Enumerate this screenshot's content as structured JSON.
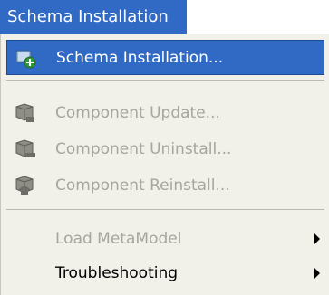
{
  "menubar": {
    "title": "Schema Installation"
  },
  "menu": {
    "items": [
      {
        "label": "Schema Installation...",
        "icon": "schema-install-icon",
        "state": "highlighted"
      },
      {
        "label": "Component Update...",
        "icon": "component-update-icon",
        "state": "disabled"
      },
      {
        "label": "Component Uninstall...",
        "icon": "component-uninstall-icon",
        "state": "disabled"
      },
      {
        "label": "Component Reinstall...",
        "icon": "component-reinstall-icon",
        "state": "disabled"
      },
      {
        "label": "Load MetaModel",
        "state": "disabled",
        "submenu": true
      },
      {
        "label": "Troubleshooting",
        "state": "enabled",
        "submenu": true
      }
    ]
  },
  "colors": {
    "highlight": "#316ac5",
    "menu_background": "#f1f0e9",
    "disabled_text": "#a7a69d"
  }
}
